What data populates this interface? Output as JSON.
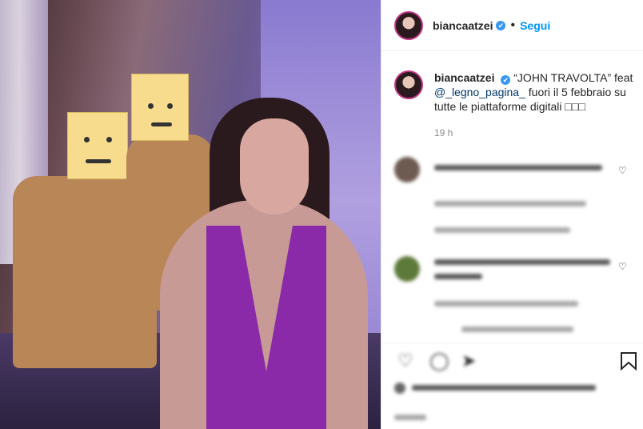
{
  "post": {
    "username": "biancaatzei",
    "verified_symbol": "✔",
    "separator": "•",
    "follow_label": "Segui",
    "caption": {
      "username": "biancaatzei",
      "text_1": "“JOHN TRAVOLTA” feat",
      "mention": "@_legno_pagina_",
      "text_2": " fuori il 5 febbraio su tutte le piattaforme digitali",
      "emojis": "□□□"
    },
    "time_ago": "19 h"
  },
  "icons": {
    "heart": "heart-icon",
    "comment": "comment-icon",
    "share": "share-icon",
    "save": "save-icon"
  },
  "colors": {
    "accent": "#0095f6",
    "verified": "#3897f0",
    "dress": "#8a2aa8",
    "box_head": "#f6dc8c"
  }
}
